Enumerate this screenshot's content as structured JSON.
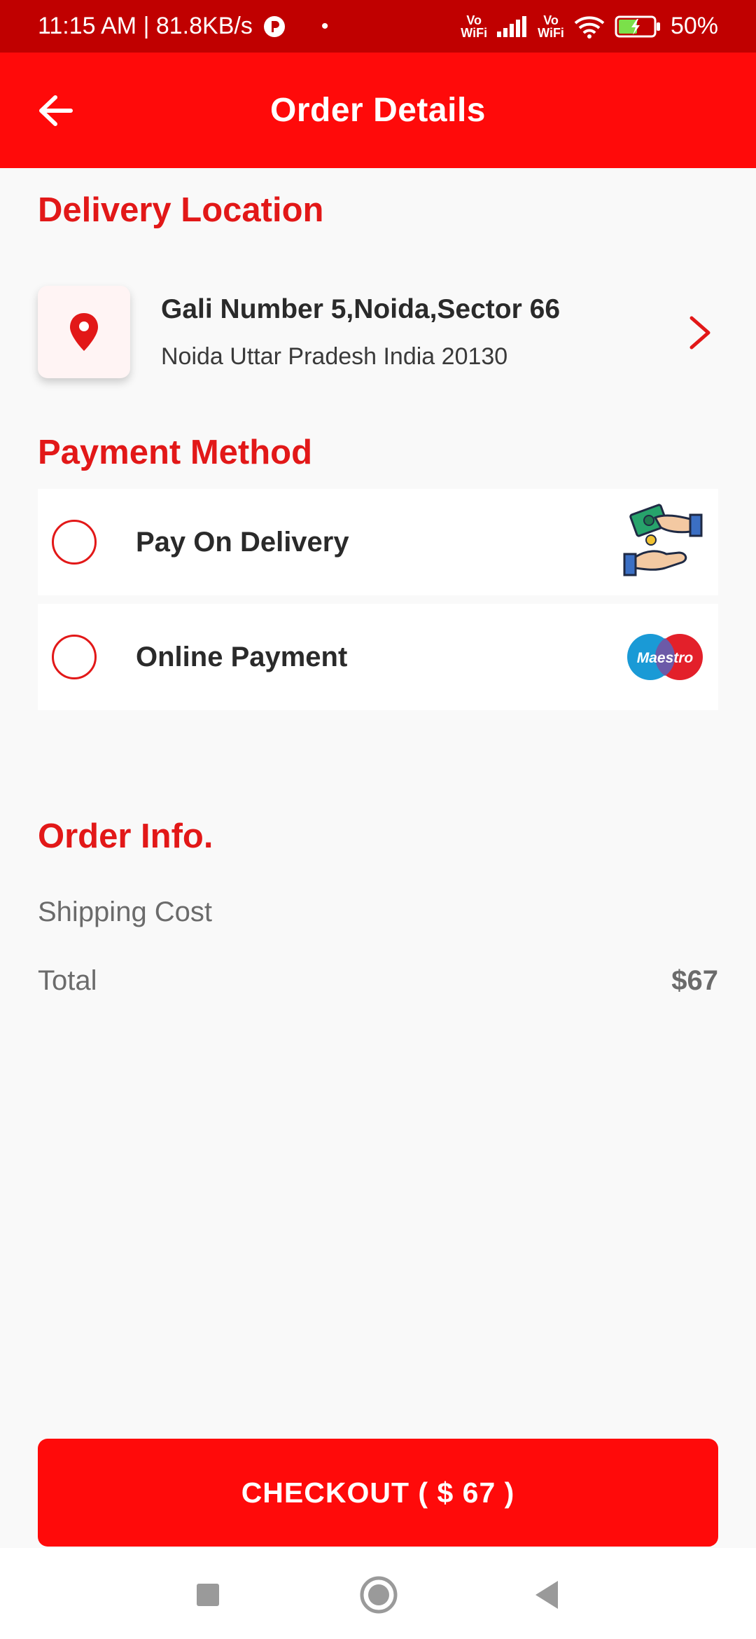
{
  "status_bar": {
    "time_speed": "11:15 AM | 81.8KB/s",
    "dot": "•",
    "vowifi_top": "Vo",
    "vowifi_bottom": "WiFi",
    "battery": "50%"
  },
  "app_bar": {
    "title": "Order Details",
    "back_icon": "arrow-left-icon"
  },
  "delivery": {
    "title": "Delivery Location",
    "address_line1": "Gali Number 5,Noida,Sector 66",
    "address_line2": "Noida Uttar Pradesh India 20130",
    "location_icon": "map-pin-icon",
    "chevron_icon": "chevron-right-icon"
  },
  "payment": {
    "title": "Payment Method",
    "options": [
      {
        "label": "Pay On Delivery",
        "icon": "cash-hands-icon",
        "selected": false
      },
      {
        "label": "Online Payment",
        "icon": "maestro-icon",
        "selected": false,
        "brand_text": "Maestro"
      }
    ]
  },
  "order_info": {
    "title": "Order Info.",
    "shipping_label": "Shipping Cost",
    "total_label": "Total",
    "total_value": "$67"
  },
  "checkout": {
    "label": "CHECKOUT ( $ 67 )"
  },
  "colors": {
    "status_bar": "#c00000",
    "app_bar": "#ff0a0a",
    "accent": "#e21818",
    "background": "#f9f9f9"
  }
}
